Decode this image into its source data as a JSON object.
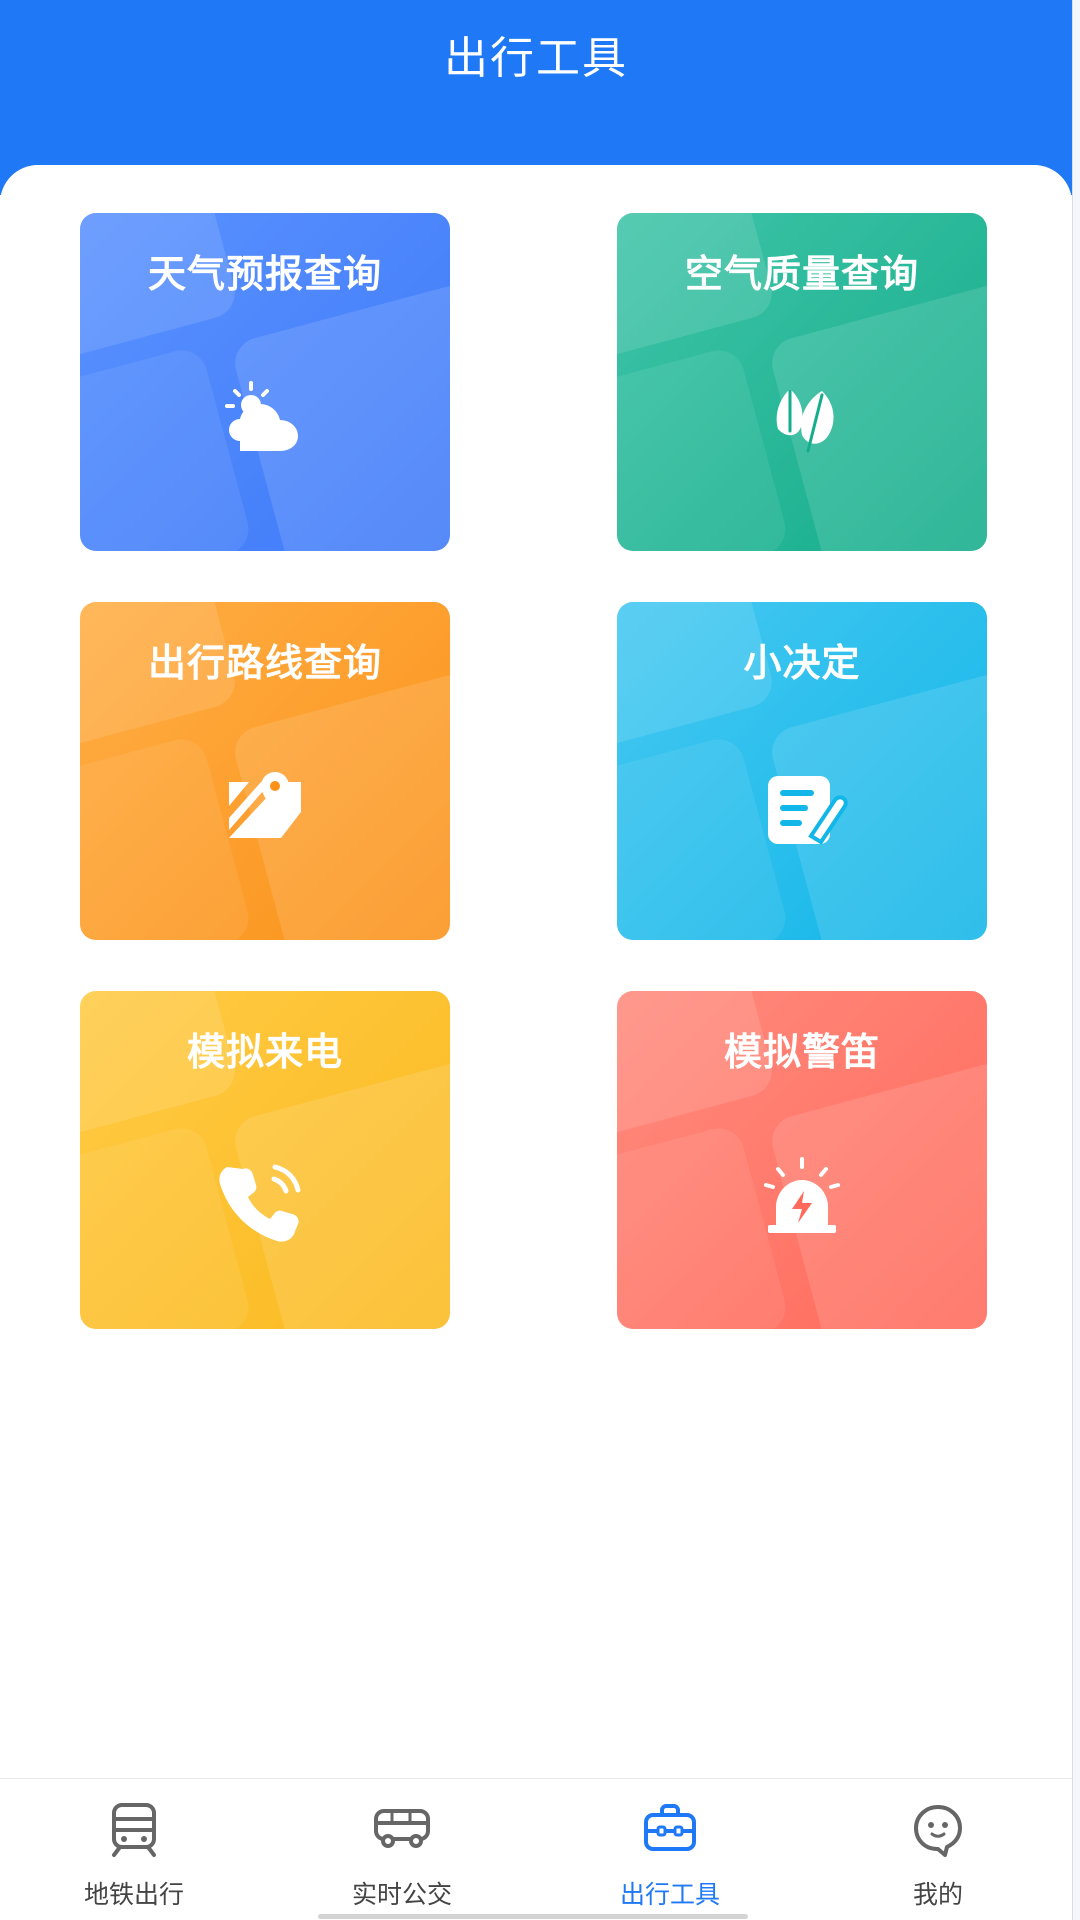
{
  "header": {
    "title": "出行工具"
  },
  "tiles": [
    {
      "label": "天气预报查询",
      "icon": "weather-icon",
      "color_from": "#5a92ff",
      "color_to": "#3f7af8"
    },
    {
      "label": "空气质量查询",
      "icon": "leaf-icon",
      "color_from": "#3fc4a8",
      "color_to": "#15ad8b"
    },
    {
      "label": "出行路线查询",
      "icon": "map-pin-icon",
      "color_from": "#ffae45",
      "color_to": "#fb921a"
    },
    {
      "label": "小决定",
      "icon": "note-edit-icon",
      "color_from": "#45c8f1",
      "color_to": "#13b6e8"
    },
    {
      "label": "模拟来电",
      "icon": "phone-ringing-icon",
      "color_from": "#ffcb45",
      "color_to": "#fbb91f"
    },
    {
      "label": "模拟警笛",
      "icon": "alarm-siren-icon",
      "color_from": "#ff8b7e",
      "color_to": "#ff6a5b"
    }
  ],
  "tabbar": {
    "items": [
      {
        "label": "地铁出行",
        "icon": "subway-icon",
        "active": false
      },
      {
        "label": "实时公交",
        "icon": "bus-icon",
        "active": false
      },
      {
        "label": "出行工具",
        "icon": "toolbox-icon",
        "active": true
      },
      {
        "label": "我的",
        "icon": "profile-icon",
        "active": false
      }
    ]
  },
  "colors": {
    "header": "#1f78f5",
    "active_tab": "#1f78f5",
    "inactive_tab": "#444444"
  }
}
